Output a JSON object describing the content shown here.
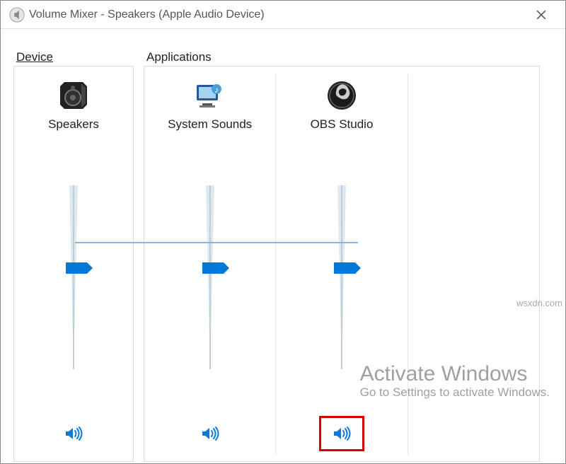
{
  "window": {
    "title": "Volume Mixer - Speakers (Apple Audio Device)"
  },
  "sections": {
    "device_header": "Device",
    "apps_header": "Applications"
  },
  "columns": [
    {
      "label": "Speakers",
      "icon": "speaker-device-icon",
      "level_pct": 55,
      "muted": false,
      "panel": "device",
      "highlighted": false
    },
    {
      "label": "System Sounds",
      "icon": "system-sounds-icon",
      "level_pct": 55,
      "muted": false,
      "panel": "apps",
      "highlighted": false
    },
    {
      "label": "OBS Studio",
      "icon": "obs-icon",
      "level_pct": 55,
      "muted": false,
      "panel": "apps",
      "highlighted": true
    }
  ],
  "watermark": {
    "line1": "Activate Windows",
    "line2": "Go to Settings to activate Windows."
  },
  "source_watermark": "wsxdn.com"
}
